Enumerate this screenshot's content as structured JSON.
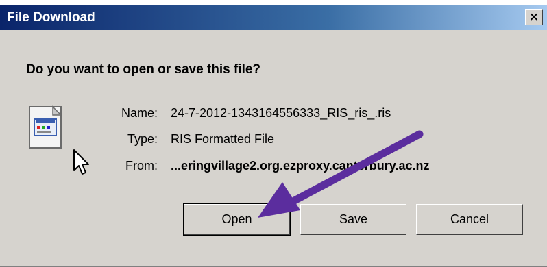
{
  "dialog": {
    "title": "File Download",
    "close_glyph": "×",
    "question": "Do you want to open or save this file?",
    "icon": "file-document-icon",
    "fields": {
      "name_label": "Name:",
      "name_value": "24-7-2012-1343164556333_RIS_ris_.ris",
      "type_label": "Type:",
      "type_value": "RIS Formatted File",
      "from_label": "From:",
      "from_value": "...eringvillage2.org.ezproxy.canterbury.ac.nz"
    },
    "buttons": {
      "open": "Open",
      "save": "Save",
      "cancel": "Cancel"
    }
  },
  "colors": {
    "titlebar": "#0a246a",
    "dialog_bg": "#d6d3ce",
    "annotation_arrow": "#5b2d9e"
  }
}
